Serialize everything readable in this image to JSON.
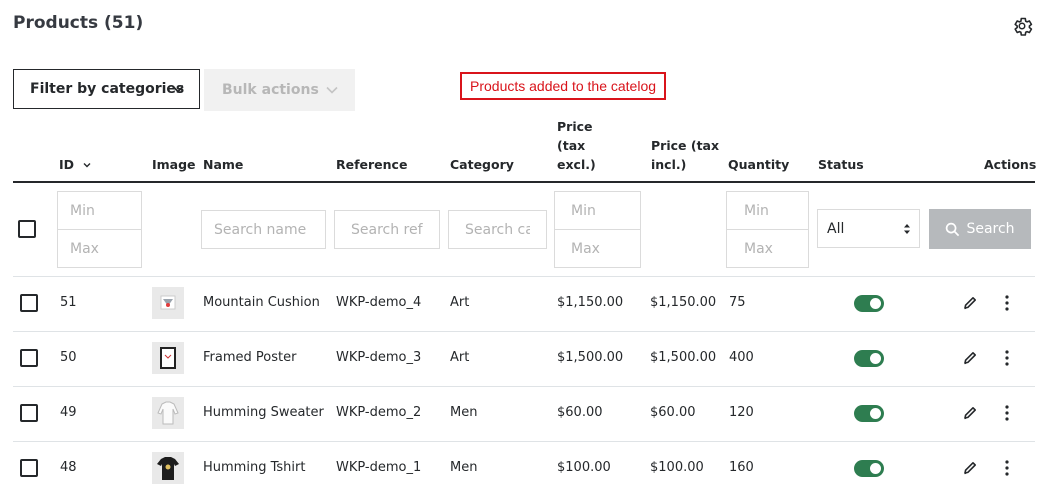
{
  "page_title": "Products (51)",
  "toolbar": {
    "filter_label": "Filter by categories",
    "bulk_label": "Bulk actions"
  },
  "notice": "Products added to the catelog",
  "columns": {
    "id": "ID",
    "image": "Image",
    "name": "Name",
    "reference": "Reference",
    "category": "Category",
    "price_excl_1": "Price",
    "price_excl_2": "(tax",
    "price_excl_3": "excl.)",
    "price_incl_1": "Price (tax",
    "price_incl_2": "incl.)",
    "quantity": "Quantity",
    "status": "Status",
    "actions": "Actions"
  },
  "filters": {
    "min_placeholder": "Min",
    "max_placeholder": "Max",
    "name_placeholder": "Search name",
    "reference_placeholder": "Search refe",
    "category_placeholder": "Search cat",
    "status_value": "All",
    "search_label": "Search"
  },
  "rows": [
    {
      "id": "51",
      "name": "Mountain Cushion",
      "reference": "WKP-demo_4",
      "category": "Art",
      "price_excl": "$1,150.00",
      "price_incl": "$1,150.00",
      "quantity": "75",
      "status": "enabled",
      "image": "cushion"
    },
    {
      "id": "50",
      "name": "Framed Poster",
      "reference": "WKP-demo_3",
      "category": "Art",
      "price_excl": "$1,500.00",
      "price_incl": "$1,500.00",
      "quantity": "400",
      "status": "enabled",
      "image": "poster"
    },
    {
      "id": "49",
      "name": "Humming Sweater",
      "reference": "WKP-demo_2",
      "category": "Men",
      "price_excl": "$60.00",
      "price_incl": "$60.00",
      "quantity": "120",
      "status": "enabled",
      "image": "sweater"
    },
    {
      "id": "48",
      "name": "Humming Tshirt",
      "reference": "WKP-demo_1",
      "category": "Men",
      "price_excl": "$100.00",
      "price_incl": "$100.00",
      "quantity": "160",
      "status": "enabled",
      "image": "tshirt"
    }
  ],
  "colors": {
    "accent_toggle": "#2e7d50",
    "notice_red": "#d9141b",
    "search_button": "#b6b9bc"
  },
  "icons": [
    "gear-icon",
    "chevron-down-icon",
    "sort-icon",
    "search-icon",
    "pencil-icon",
    "kebab-icon"
  ]
}
